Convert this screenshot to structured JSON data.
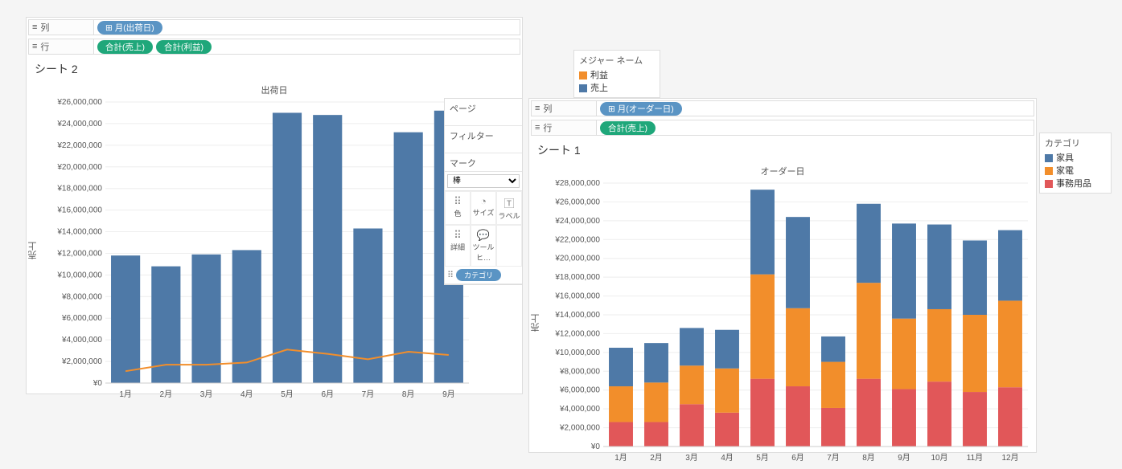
{
  "sheet2": {
    "title": "シート 2",
    "axisTop": "出荷日",
    "yAxisLabel": "売上",
    "cols_label": "列",
    "rows_label": "行",
    "col_pill": "⊞ 月(出荷日)",
    "row_pill1": "合計(売上)",
    "row_pill2": "合計(利益)",
    "side": {
      "pages": "ページ",
      "filters": "フィルター",
      "marks": "マーク",
      "markType": "棒",
      "color": "色",
      "size": "サイズ",
      "label": "ラベル",
      "detail": "詳細",
      "tooltip": "ツールヒ…",
      "catPill": "カテゴリ"
    },
    "legend": {
      "title": "メジャー ネーム",
      "items": [
        {
          "color": "#f28e2b",
          "label": "利益"
        },
        {
          "color": "#4e79a7",
          "label": "売上"
        }
      ]
    }
  },
  "sheet1": {
    "title": "シート 1",
    "axisTop": "オーダー日",
    "yAxisLabel": "売上",
    "cols_label": "列",
    "rows_label": "行",
    "col_pill": "⊞ 月(オーダー日)",
    "row_pill": "合計(売上)",
    "legend": {
      "title": "カテゴリ",
      "items": [
        {
          "color": "#4e79a7",
          "label": "家具"
        },
        {
          "color": "#f28e2b",
          "label": "家電"
        },
        {
          "color": "#e15759",
          "label": "事務用品"
        }
      ]
    }
  },
  "chart_data": [
    {
      "id": "sheet2-chart",
      "type": "bar+line",
      "title": "シート 2",
      "xlabel": "出荷日",
      "ylabel": "売上",
      "categories": [
        "1月",
        "2月",
        "3月",
        "4月",
        "5月",
        "6月",
        "7月",
        "8月",
        "9月"
      ],
      "ylim": [
        0,
        26000000
      ],
      "bar_series": {
        "name": "売上",
        "values": [
          11800000,
          10800000,
          11900000,
          12300000,
          25000000,
          24800000,
          14300000,
          23200000,
          25200000
        ]
      },
      "line_series": {
        "name": "利益",
        "values": [
          1100000,
          1700000,
          1700000,
          1900000,
          3100000,
          2700000,
          2200000,
          2900000,
          2600000
        ]
      }
    },
    {
      "id": "sheet1-chart",
      "type": "stacked-bar",
      "title": "シート 1",
      "xlabel": "オーダー日",
      "ylabel": "売上",
      "categories": [
        "1月",
        "2月",
        "3月",
        "4月",
        "5月",
        "6月",
        "7月",
        "8月",
        "9月",
        "10月",
        "11月",
        "12月"
      ],
      "ylim": [
        0,
        28000000
      ],
      "series": [
        {
          "name": "事務用品",
          "color": "#e15759",
          "values": [
            2600000,
            2600000,
            4500000,
            3600000,
            7200000,
            6400000,
            4100000,
            7200000,
            6100000,
            6900000,
            5800000,
            6300000
          ]
        },
        {
          "name": "家電",
          "color": "#f28e2b",
          "values": [
            3800000,
            4200000,
            4100000,
            4700000,
            11100000,
            8300000,
            4900000,
            10200000,
            7500000,
            7700000,
            8200000,
            9200000
          ]
        },
        {
          "name": "家具",
          "color": "#4e79a7",
          "values": [
            4100000,
            4200000,
            4000000,
            4100000,
            9000000,
            9700000,
            2700000,
            8400000,
            10100000,
            9000000,
            7900000,
            7500000
          ]
        }
      ]
    }
  ]
}
